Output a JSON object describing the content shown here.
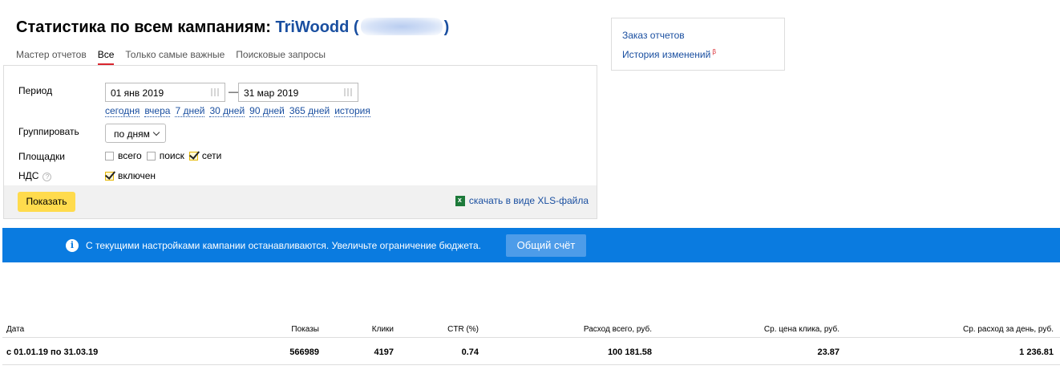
{
  "header": {
    "title_prefix": "Статистика по всем кампаниям:",
    "campaign_name": "TriWoodd (",
    "campaign_suffix": ")"
  },
  "tabs": [
    {
      "label": "Мастер отчетов",
      "active": false
    },
    {
      "label": "Все",
      "active": true
    },
    {
      "label": "Только самые важные",
      "active": false
    },
    {
      "label": "Поисковые запросы",
      "active": false
    }
  ],
  "form": {
    "period_label": "Период",
    "date_from": "01 янв 2019",
    "date_separator": "—",
    "date_to": "31 мар 2019",
    "quick_periods": [
      "сегодня",
      "вчера",
      "7 дней",
      "30 дней",
      "90 дней",
      "365 дней",
      "история"
    ],
    "group_label": "Группировать",
    "group_value": "по дням",
    "platforms_label": "Площадки",
    "platforms": [
      {
        "label": "всего",
        "checked": false
      },
      {
        "label": "поиск",
        "checked": false
      },
      {
        "label": "сети",
        "checked": true
      }
    ],
    "vat_label": "НДС",
    "vat_help": "?",
    "vat_option": {
      "label": "включен",
      "checked": true
    },
    "show_button": "Показать",
    "xls_link": "скачать в виде XLS-файла"
  },
  "side": {
    "order_reports": "Заказ отчетов",
    "change_history": "История изменений",
    "beta_mark": "β"
  },
  "banner": {
    "message": "С текущими настройками кампании останавливаются. Увеличьте ограничение бюджета.",
    "button": "Общий счёт",
    "color": "#0a7be0"
  },
  "stats": {
    "columns": [
      "Дата",
      "Показы",
      "Клики",
      "CTR (%)",
      "Расход всего, руб.",
      "Ср. цена клика, руб.",
      "Ср. расход за день, руб."
    ],
    "rows": [
      [
        "с 01.01.19 по 31.03.19",
        "566989",
        "4197",
        "0.74",
        "100 181.58",
        "23.87",
        "1 236.81"
      ]
    ]
  }
}
